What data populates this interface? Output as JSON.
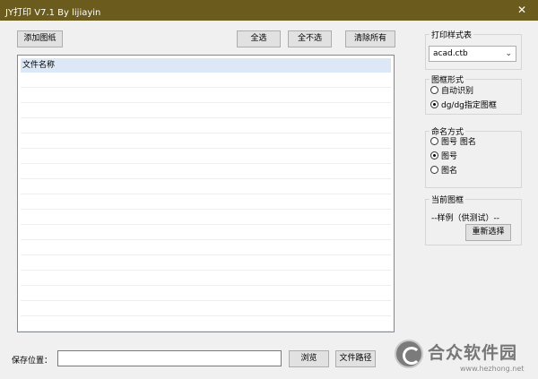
{
  "window": {
    "title": "JY打印 V7.1 By lijiayin",
    "close": "✕"
  },
  "toolbar": {
    "add_drawing": "添加图纸",
    "select_all": "全选",
    "select_none": "全不选",
    "clear_all": "清除所有"
  },
  "file_list": {
    "column_header": "文件名称",
    "rows": []
  },
  "print_style": {
    "legend": "打印样式表",
    "selected": "acad.ctb"
  },
  "frame_form": {
    "legend": "图框形式",
    "options": [
      {
        "label": "自动识别",
        "checked": false
      },
      {
        "label": "dg/dg指定图框",
        "checked": true
      }
    ]
  },
  "naming": {
    "legend": "命名方式",
    "options": [
      {
        "label": "图号  图名",
        "checked": false
      },
      {
        "label": "图号",
        "checked": true
      },
      {
        "label": "图名",
        "checked": false
      }
    ]
  },
  "current_frame": {
    "legend": "当前图框",
    "value": "--样例（供测试）--",
    "reselect": "重新选择"
  },
  "save": {
    "label": "保存位置：",
    "value": "",
    "browse": "浏览",
    "file_path": "文件路径"
  },
  "watermark": {
    "name": "合众软件园",
    "url": "www.hezhong.net"
  }
}
